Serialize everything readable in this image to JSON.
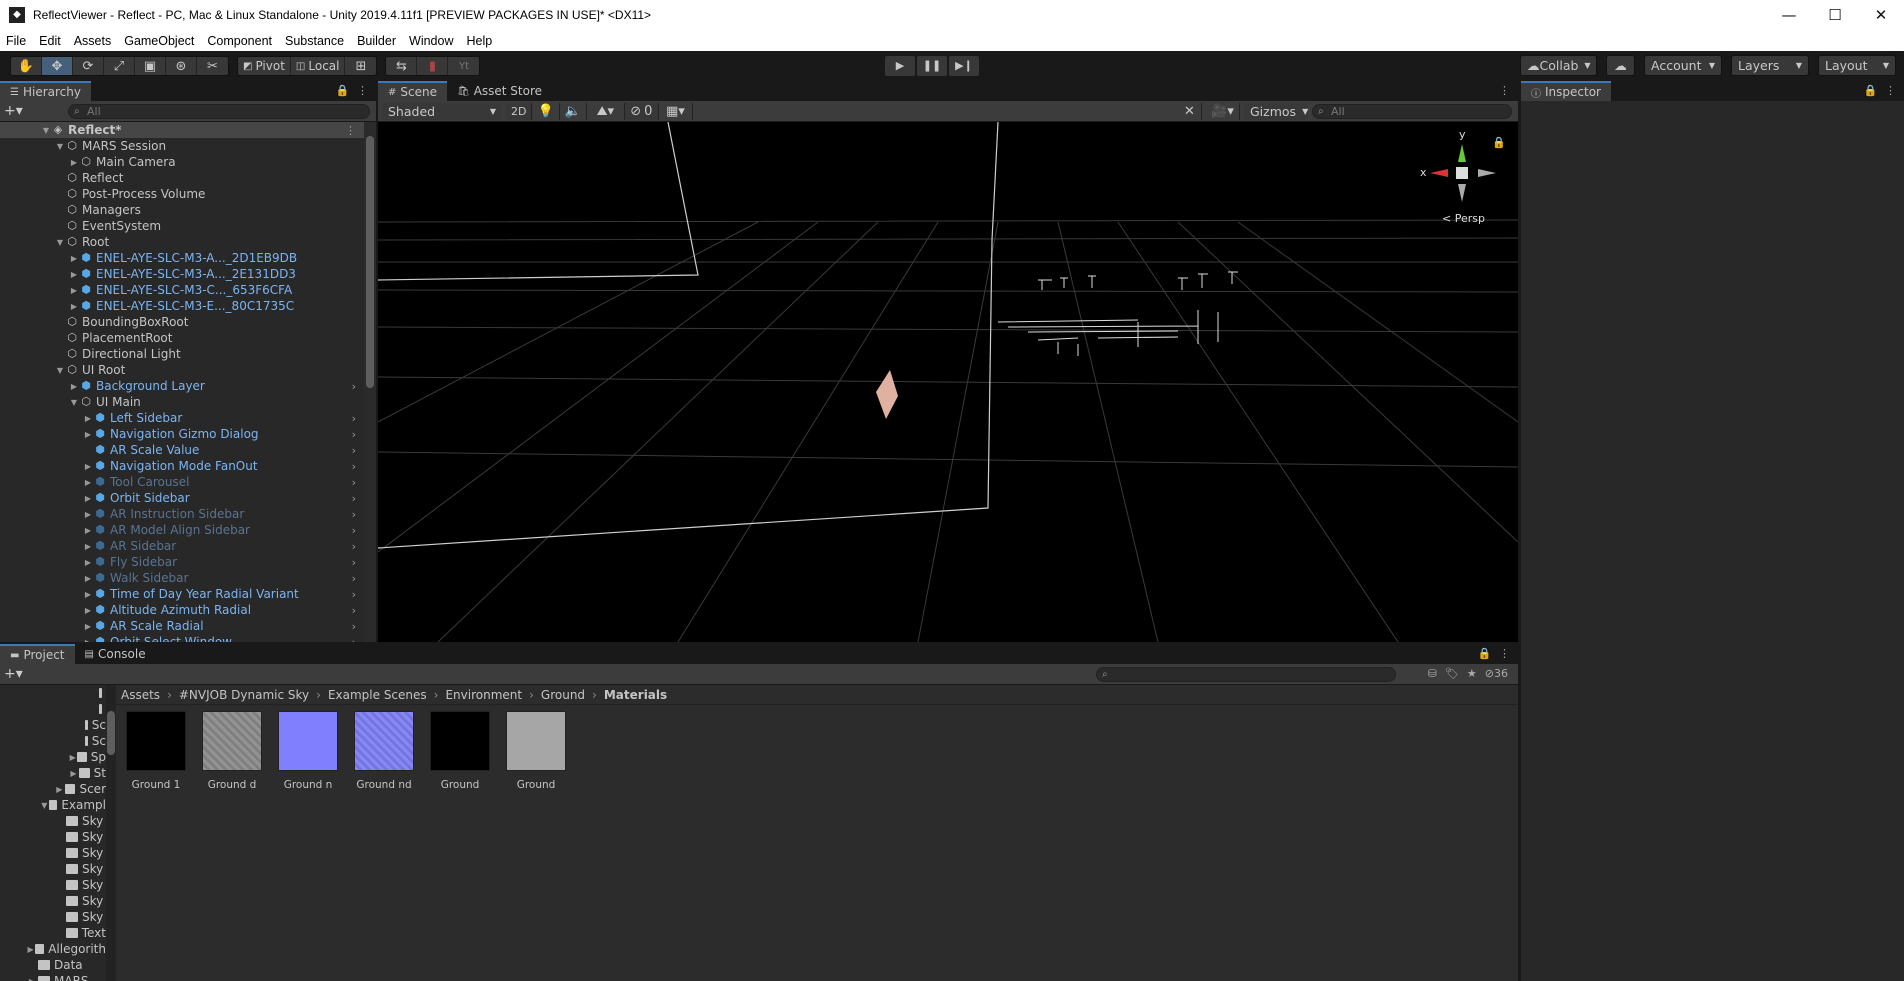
{
  "window": {
    "title": "ReflectViewer - Reflect - PC, Mac & Linux Standalone - Unity 2019.4.11f1 [PREVIEW PACKAGES IN USE]* <DX11>",
    "minimize": "—",
    "maximize": "☐",
    "close": "✕"
  },
  "menu": [
    "File",
    "Edit",
    "Assets",
    "GameObject",
    "Component",
    "Substance",
    "Builder",
    "Window",
    "Help"
  ],
  "toolbar": {
    "pivot": "Pivot",
    "local": "Local",
    "collab": "Collab",
    "account": "Account",
    "layers": "Layers",
    "layout": "Layout"
  },
  "hierarchy": {
    "tab": "Hierarchy",
    "search_placeholder": "All",
    "rows": [
      {
        "label": "Reflect*",
        "depth": 0,
        "arrow": "▼",
        "type": "scene"
      },
      {
        "label": "MARS Session",
        "depth": 1,
        "arrow": "▼",
        "type": "go"
      },
      {
        "label": "Main Camera",
        "depth": 2,
        "arrow": "▶",
        "type": "go"
      },
      {
        "label": "Reflect",
        "depth": 1,
        "arrow": "",
        "type": "go"
      },
      {
        "label": "Post-Process Volume",
        "depth": 1,
        "arrow": "",
        "type": "go"
      },
      {
        "label": "Managers",
        "depth": 1,
        "arrow": "",
        "type": "go"
      },
      {
        "label": "EventSystem",
        "depth": 1,
        "arrow": "",
        "type": "go"
      },
      {
        "label": "Root",
        "depth": 1,
        "arrow": "▼",
        "type": "go"
      },
      {
        "label": "ENEL-AYE-SLC-M3-A..._2D1EB9DB",
        "depth": 2,
        "arrow": "▶",
        "type": "prefab"
      },
      {
        "label": "ENEL-AYE-SLC-M3-A..._2E131DD3",
        "depth": 2,
        "arrow": "▶",
        "type": "prefab"
      },
      {
        "label": "ENEL-AYE-SLC-M3-C..._653F6CFA",
        "depth": 2,
        "arrow": "▶",
        "type": "prefab"
      },
      {
        "label": "ENEL-AYE-SLC-M3-E..._80C1735C",
        "depth": 2,
        "arrow": "▶",
        "type": "prefab"
      },
      {
        "label": "BoundingBoxRoot",
        "depth": 1,
        "arrow": "",
        "type": "go"
      },
      {
        "label": "PlacementRoot",
        "depth": 1,
        "arrow": "",
        "type": "go"
      },
      {
        "label": "Directional Light",
        "depth": 1,
        "arrow": "",
        "type": "go"
      },
      {
        "label": "UI Root",
        "depth": 1,
        "arrow": "▼",
        "type": "go"
      },
      {
        "label": "Background Layer",
        "depth": 2,
        "arrow": "▶",
        "type": "prefab",
        "chev": true
      },
      {
        "label": "UI Main",
        "depth": 2,
        "arrow": "▼",
        "type": "go"
      },
      {
        "label": "Left Sidebar",
        "depth": 3,
        "arrow": "▶",
        "type": "prefab",
        "chev": true
      },
      {
        "label": "Navigation Gizmo Dialog",
        "depth": 3,
        "arrow": "▶",
        "type": "prefab",
        "chev": true
      },
      {
        "label": "AR Scale Value",
        "depth": 3,
        "arrow": "",
        "type": "prefab",
        "chev": true
      },
      {
        "label": "Navigation Mode FanOut",
        "depth": 3,
        "arrow": "▶",
        "type": "prefab",
        "chev": true
      },
      {
        "label": "Tool Carousel",
        "depth": 3,
        "arrow": "▶",
        "type": "dim",
        "chev": true
      },
      {
        "label": "Orbit Sidebar",
        "depth": 3,
        "arrow": "▶",
        "type": "prefab",
        "chev": true
      },
      {
        "label": "AR Instruction Sidebar",
        "depth": 3,
        "arrow": "▶",
        "type": "dim",
        "chev": true
      },
      {
        "label": "AR Model Align  Sidebar",
        "depth": 3,
        "arrow": "▶",
        "type": "dim",
        "chev": true
      },
      {
        "label": "AR Sidebar",
        "depth": 3,
        "arrow": "▶",
        "type": "dim",
        "chev": true
      },
      {
        "label": "Fly Sidebar",
        "depth": 3,
        "arrow": "▶",
        "type": "dim",
        "chev": true
      },
      {
        "label": "Walk Sidebar",
        "depth": 3,
        "arrow": "▶",
        "type": "dim",
        "chev": true
      },
      {
        "label": "Time of Day Year Radial Variant",
        "depth": 3,
        "arrow": "▶",
        "type": "prefab",
        "chev": true
      },
      {
        "label": "Altitude Azimuth Radial",
        "depth": 3,
        "arrow": "▶",
        "type": "prefab",
        "chev": true
      },
      {
        "label": "AR Scale Radial",
        "depth": 3,
        "arrow": "▶",
        "type": "prefab",
        "chev": true
      },
      {
        "label": "Orbit Select Window",
        "depth": 3,
        "arrow": "▶",
        "type": "prefab",
        "chev": true
      }
    ]
  },
  "scene": {
    "tab_scene": "Scene",
    "tab_asset_store": "Asset Store",
    "shading": "Shaded",
    "mode_2d": "2D",
    "hidden_count": "0",
    "gizmos": "Gizmos",
    "search_placeholder": "All",
    "persp": "Persp",
    "axis_x": "x",
    "axis_y": "y"
  },
  "inspector": {
    "tab": "Inspector"
  },
  "project": {
    "tab_project": "Project",
    "tab_console": "Console",
    "hidden_count": "36",
    "breadcrumb": [
      "Assets",
      "#NVJOB Dynamic Sky",
      "Example Scenes",
      "Environment",
      "Ground",
      "Materials"
    ],
    "tree": [
      {
        "label": "",
        "depth": 6,
        "arrow": ""
      },
      {
        "label": "",
        "depth": 6,
        "arrow": ""
      },
      {
        "label": "Sc",
        "depth": 5,
        "arrow": ""
      },
      {
        "label": "Sc",
        "depth": 5,
        "arrow": ""
      },
      {
        "label": "Sp",
        "depth": 4,
        "arrow": "▶"
      },
      {
        "label": "St",
        "depth": 4,
        "arrow": "▶"
      },
      {
        "label": "Scer",
        "depth": 3,
        "arrow": "▶"
      },
      {
        "label": "Exampl",
        "depth": 2,
        "arrow": "▼",
        "open": true
      },
      {
        "label": "Sky",
        "depth": 3,
        "arrow": ""
      },
      {
        "label": "Sky",
        "depth": 3,
        "arrow": ""
      },
      {
        "label": "Sky",
        "depth": 3,
        "arrow": ""
      },
      {
        "label": "Sky",
        "depth": 3,
        "arrow": ""
      },
      {
        "label": "Sky",
        "depth": 3,
        "arrow": ""
      },
      {
        "label": "Sky",
        "depth": 3,
        "arrow": ""
      },
      {
        "label": "Sky",
        "depth": 3,
        "arrow": ""
      },
      {
        "label": "Text",
        "depth": 3,
        "arrow": ""
      },
      {
        "label": "Allegorith",
        "depth": 1,
        "arrow": "▶"
      },
      {
        "label": "Data",
        "depth": 1,
        "arrow": ""
      },
      {
        "label": "MARS",
        "depth": 1,
        "arrow": "▶"
      }
    ],
    "assets": [
      {
        "label": "Ground 1",
        "color": "#000000"
      },
      {
        "label": "Ground d",
        "color": "#8a8a8a"
      },
      {
        "label": "Ground n",
        "color": "#8080ff"
      },
      {
        "label": "Ground nd",
        "color": "#7e7ef4"
      },
      {
        "label": "Ground",
        "color": "#000000"
      },
      {
        "label": "Ground",
        "color": "#a6a6a6"
      }
    ]
  }
}
